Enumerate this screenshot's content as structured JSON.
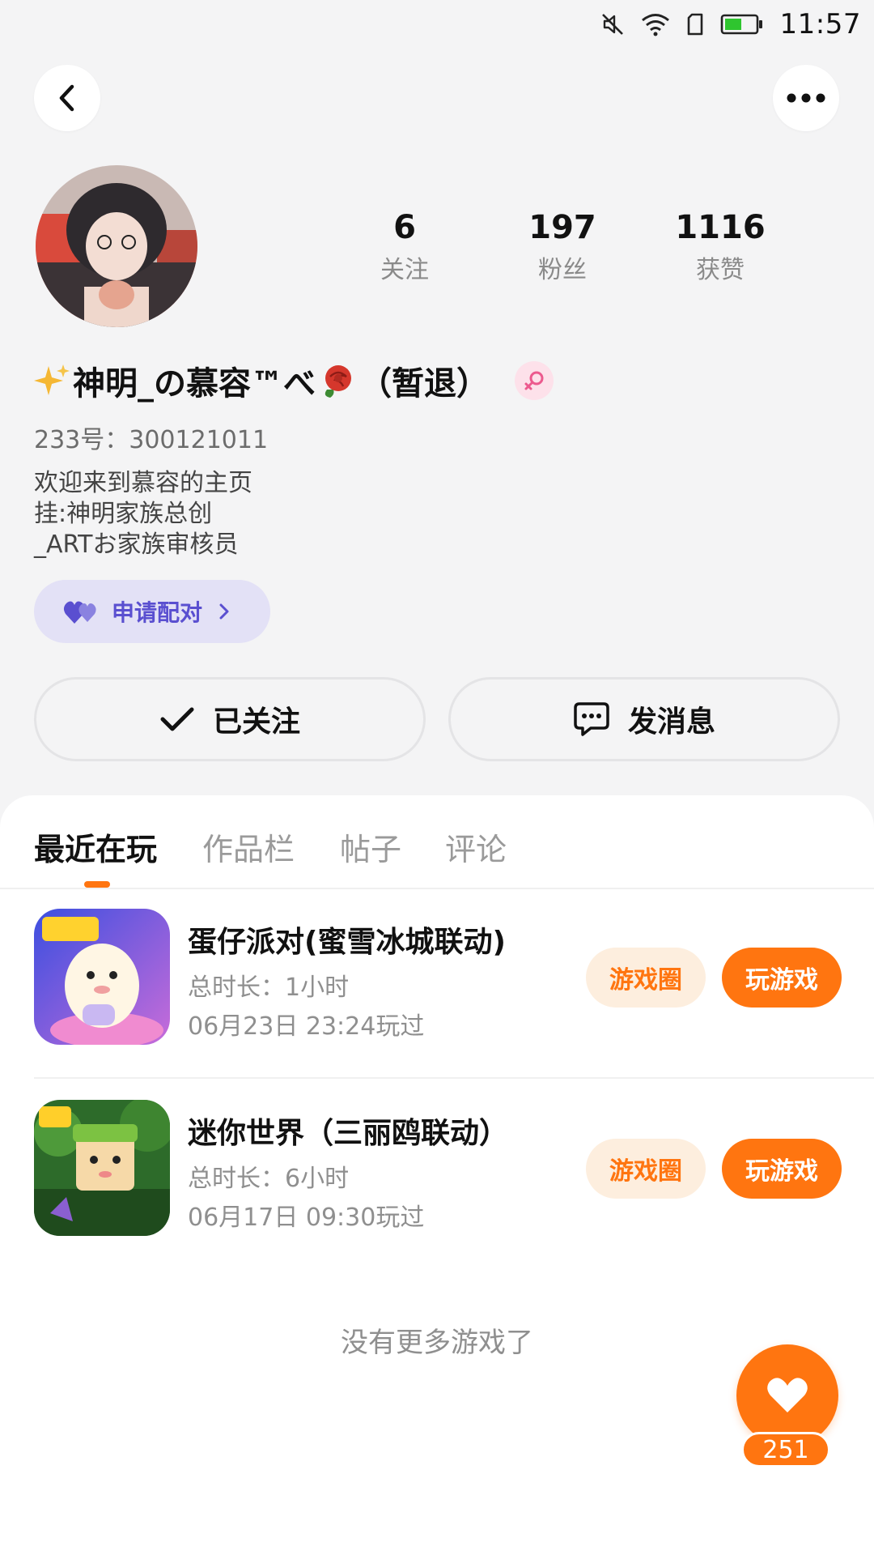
{
  "status_bar": {
    "time": "11:57",
    "icons": [
      "mute-icon",
      "wifi-icon",
      "sim-icon",
      "battery-icon"
    ]
  },
  "header": {
    "back_icon": "chevron-left-icon",
    "more_icon": "more-dots-icon"
  },
  "profile": {
    "stats": [
      {
        "value": "6",
        "label": "关注"
      },
      {
        "value": "197",
        "label": "粉丝"
      },
      {
        "value": "1116",
        "label": "获赞"
      }
    ],
    "nickname": "神明_の慕容™べ",
    "nickname_suffix": "（暂退）",
    "gender": "female",
    "uid": "233号：300121011",
    "bio_lines": [
      "欢迎来到慕容的主页",
      "挂:神明家族总创",
      "_ARTお家族审核员"
    ],
    "pair_button": "申请配对",
    "follow_button": "已关注",
    "message_button": "发消息"
  },
  "tabs": [
    {
      "label": "最近在玩",
      "active": true
    },
    {
      "label": "作品栏",
      "active": false
    },
    {
      "label": "帖子",
      "active": false
    },
    {
      "label": "评论",
      "active": false
    }
  ],
  "games": [
    {
      "name": "蛋仔派对(蜜雪冰城联动)",
      "duration": "总时长：1小时",
      "last_played": "06月23日 23:24玩过",
      "circle_button": "游戏圈",
      "play_button": "玩游戏"
    },
    {
      "name": "迷你世界（三丽鸥联动）",
      "duration": "总时长：6小时",
      "last_played": "06月17日 09:30玩过",
      "circle_button": "游戏圈",
      "play_button": "玩游戏"
    }
  ],
  "no_more_text": "没有更多游戏了",
  "like": {
    "count": "251"
  },
  "colors": {
    "accent": "#ff7510",
    "pair_bg": "#e3e1f6",
    "pair_text": "#5a4fd0",
    "page_bg": "#f4f4f5"
  }
}
